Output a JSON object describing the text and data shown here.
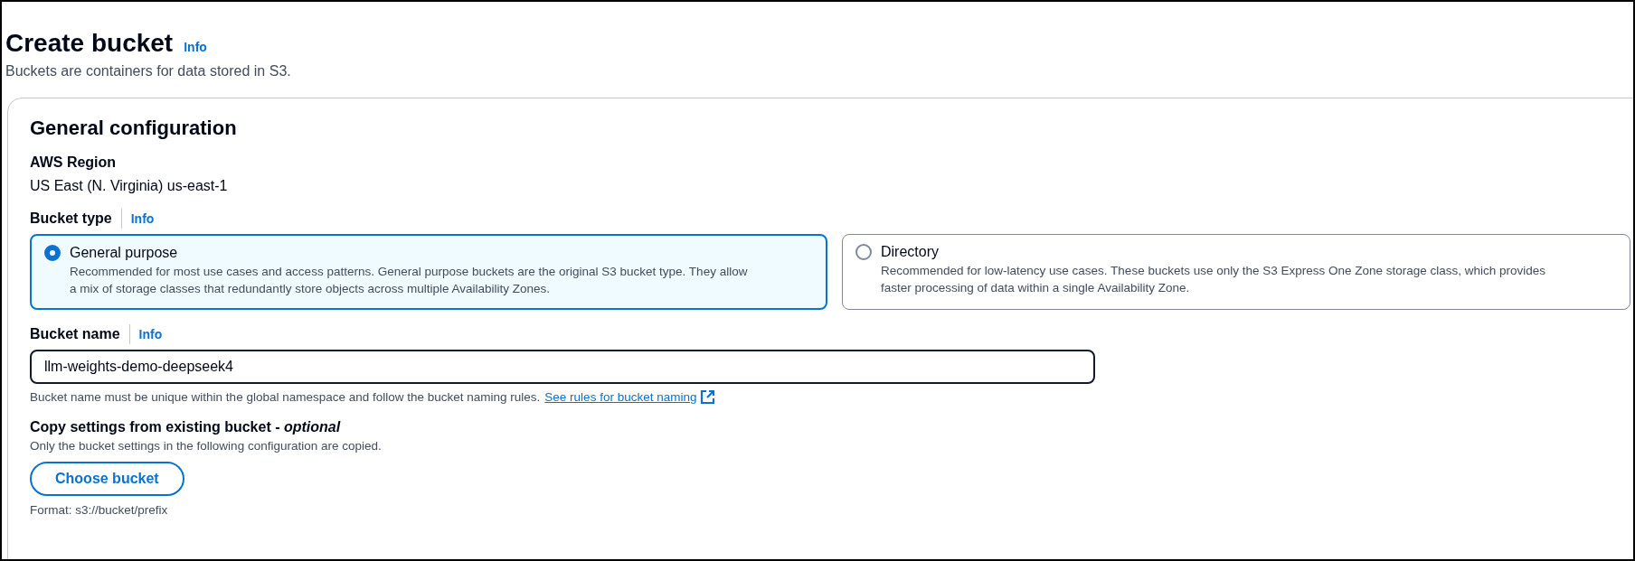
{
  "page": {
    "title": "Create bucket",
    "info_link": "Info",
    "description": "Buckets are containers for data stored in S3."
  },
  "general_configuration": {
    "heading": "General configuration",
    "region": {
      "label": "AWS Region",
      "value": "US East (N. Virginia) us-east-1"
    },
    "bucket_type": {
      "label": "Bucket type",
      "info_link": "Info",
      "options": [
        {
          "label": "General purpose",
          "description": "Recommended for most use cases and access patterns. General purpose buckets are the original S3 bucket type. They allow a mix of storage classes that redundantly store objects across multiple Availability Zones.",
          "selected": true
        },
        {
          "label": "Directory",
          "description": "Recommended for low-latency use cases. These buckets use only the S3 Express One Zone storage class, which provides faster processing of data within a single Availability Zone.",
          "selected": false
        }
      ]
    },
    "bucket_name": {
      "label": "Bucket name",
      "info_link": "Info",
      "value": "llm-weights-demo-deepseek4",
      "hint": "Bucket name must be unique within the global namespace and follow the bucket naming rules.",
      "link": "See rules for bucket naming"
    },
    "copy_settings": {
      "label": "Copy settings from existing bucket - *optional*",
      "description": "Only the bucket settings in the following configuration are copied.",
      "button": "Choose bucket",
      "format_hint": "Format: s3://bucket/prefix"
    }
  }
}
